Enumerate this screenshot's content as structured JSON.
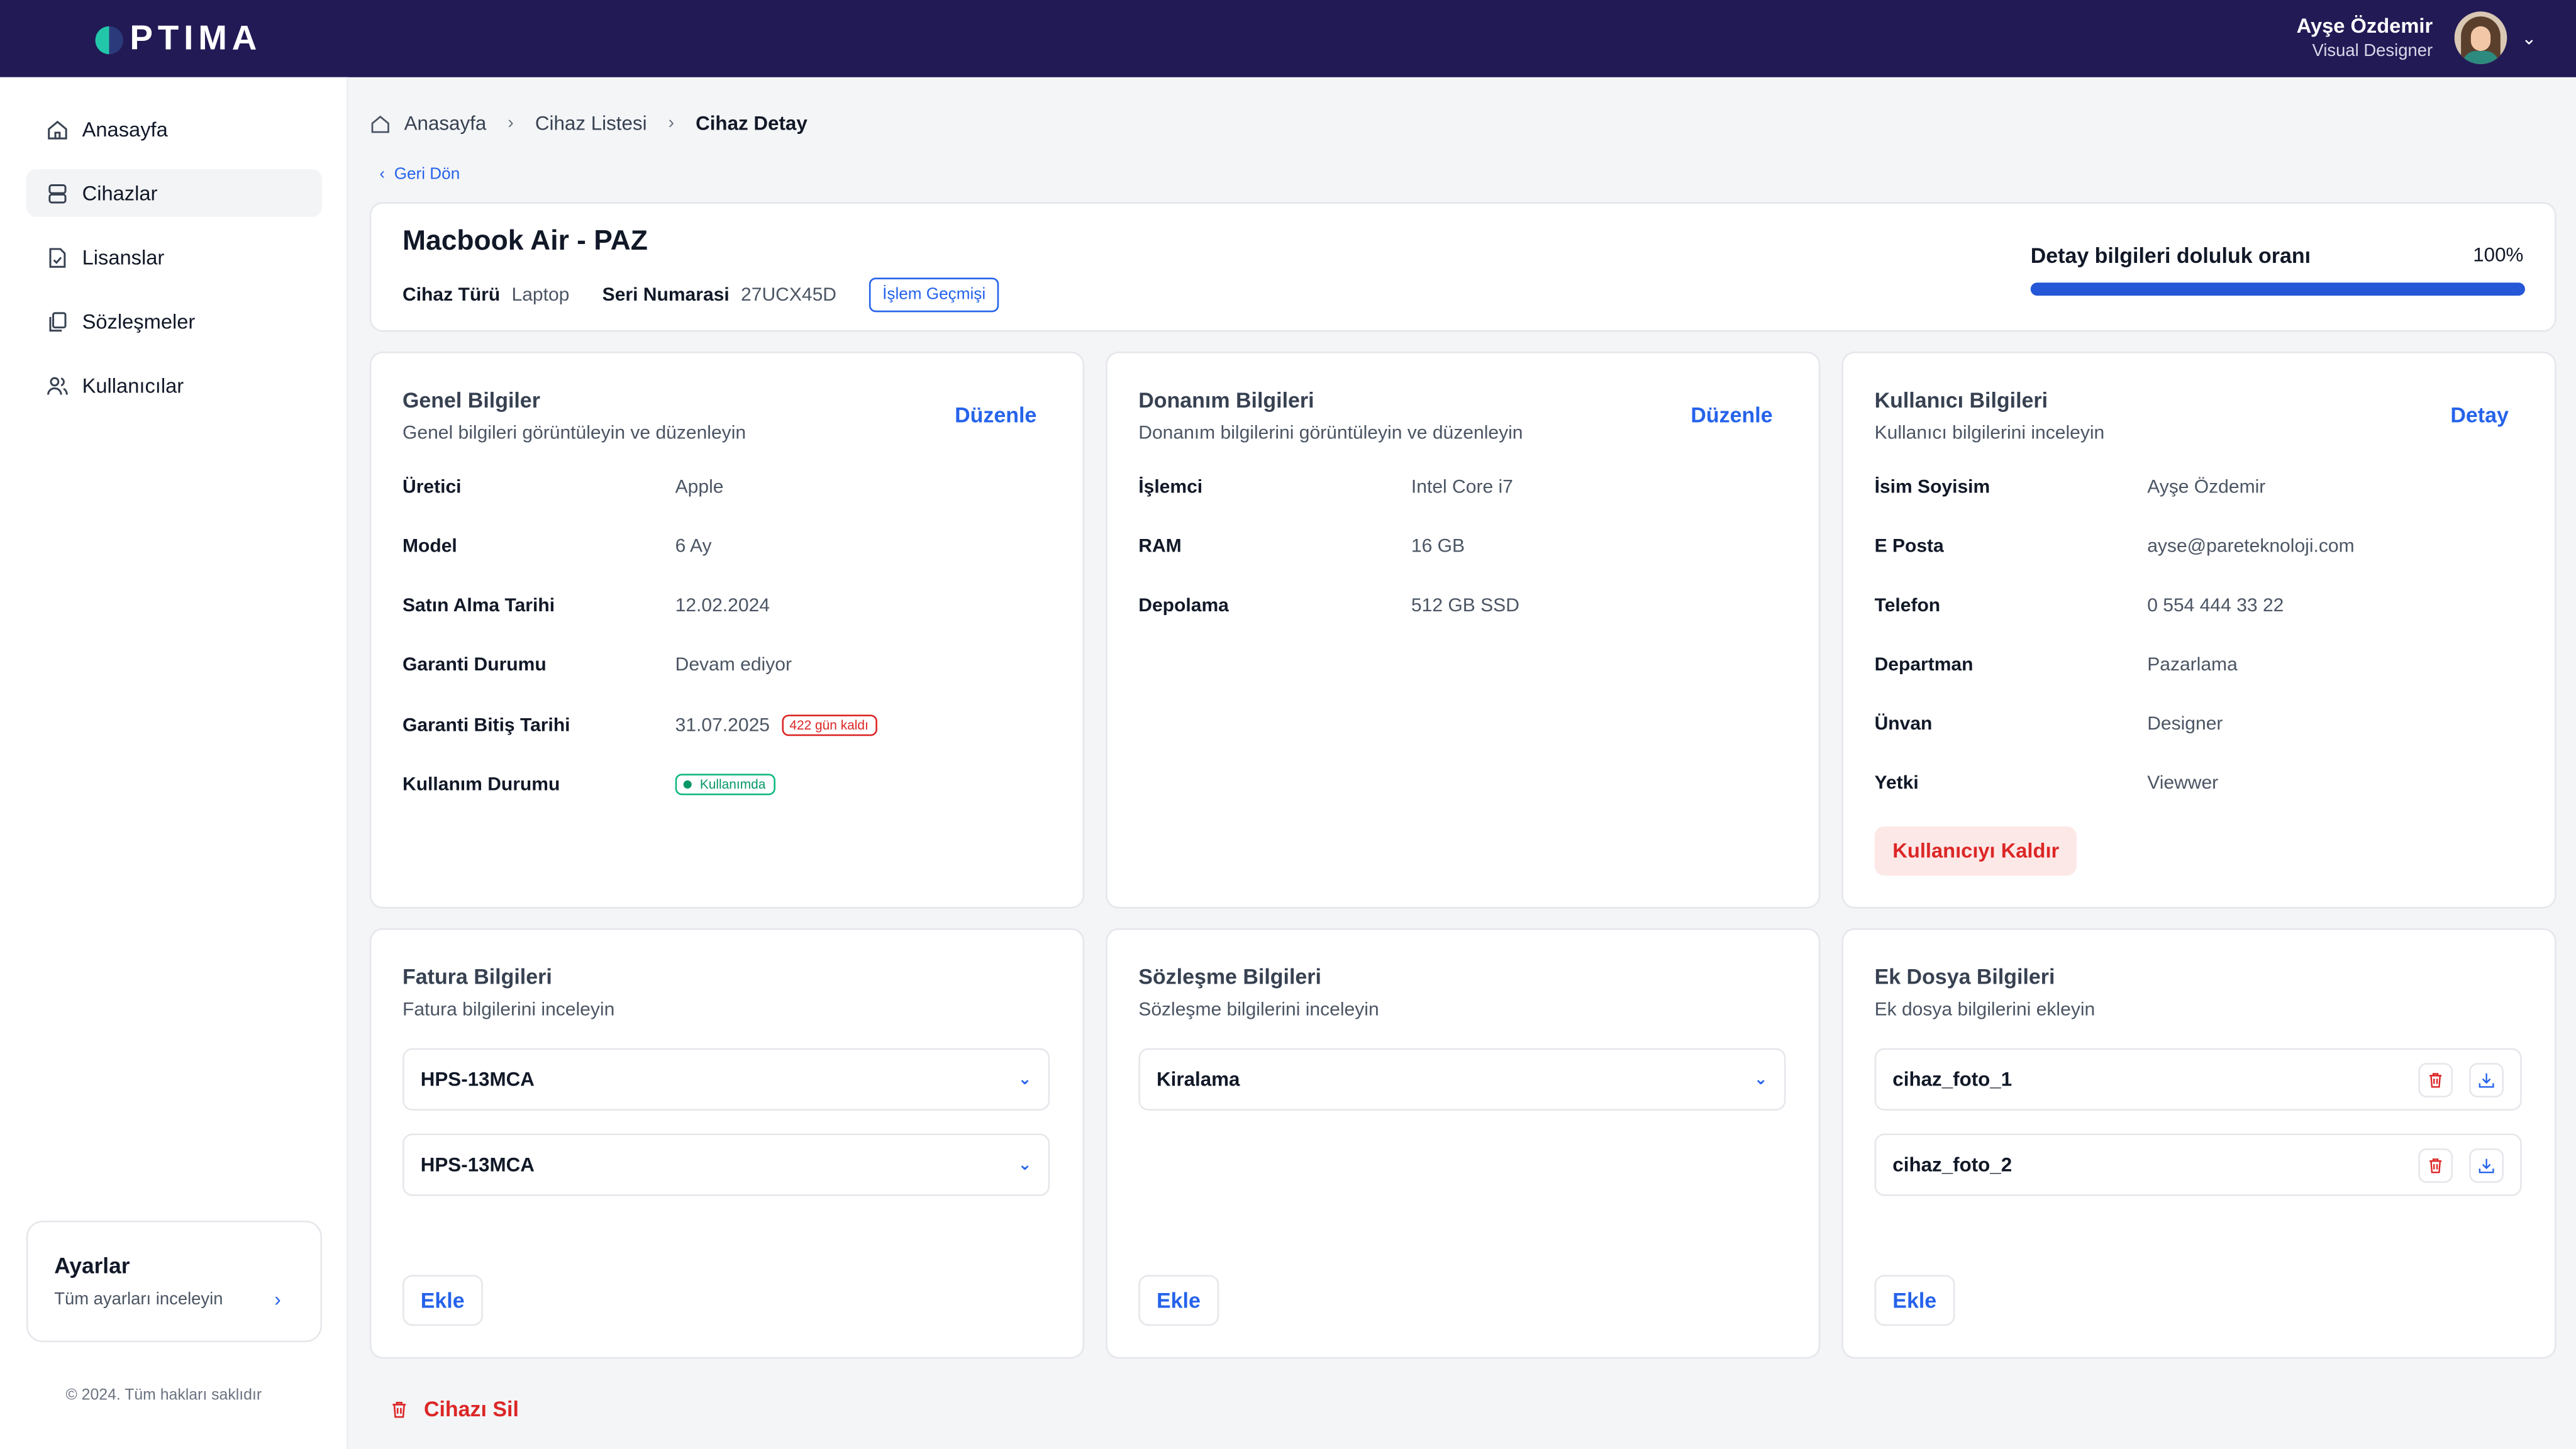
{
  "brand": {
    "logo_text": "PTIMA"
  },
  "user": {
    "name": "Ayşe Özdemir",
    "role": "Visual Designer"
  },
  "sidebar": {
    "items": [
      {
        "label": "Anasayfa",
        "icon": "home-icon"
      },
      {
        "label": "Cihazlar",
        "icon": "device-icon",
        "active": true
      },
      {
        "label": "Lisanslar",
        "icon": "license-icon"
      },
      {
        "label": "Sözleşmeler",
        "icon": "contracts-icon"
      },
      {
        "label": "Kullanıcılar",
        "icon": "users-icon"
      }
    ],
    "settings": {
      "title": "Ayarlar",
      "subtitle": "Tüm ayarları inceleyin"
    },
    "copyright": "© 2024. Tüm hakları saklıdır"
  },
  "breadcrumb": {
    "home": "Anasayfa",
    "list": "Cihaz Listesi",
    "current": "Cihaz Detay"
  },
  "back_label": "Geri Dön",
  "device": {
    "title": "Macbook Air - PAZ",
    "type_label": "Cihaz Türü",
    "type_value": "Laptop",
    "serial_label": "Seri Numarasi",
    "serial_value": "27UCX45D",
    "history_button": "İşlem Geçmişi",
    "completion_label": "Detay bilgileri doluluk oranı",
    "completion_text": "100%",
    "completion_value": 1.0
  },
  "general": {
    "title": "Genel Bilgiler",
    "subtitle": "Genel bilgileri görüntüleyin ve düzenleyin",
    "action": "Düzenle",
    "rows": [
      {
        "k": "Üretici",
        "v": "Apple"
      },
      {
        "k": "Model",
        "v": "6 Ay"
      },
      {
        "k": "Satın Alma Tarihi",
        "v": "12.02.2024"
      },
      {
        "k": "Garanti Durumu",
        "v": "Devam ediyor"
      },
      {
        "k": "Garanti Bitiş Tarihi",
        "v": "31.07.2025",
        "badge": "422 gün kaldı"
      },
      {
        "k": "Kullanım Durumu",
        "badge": "Kullanımda"
      }
    ]
  },
  "hardware": {
    "title": "Donanım Bilgileri",
    "subtitle": "Donanım bilgilerini görüntüleyin ve düzenleyin",
    "action": "Düzenle",
    "rows": [
      {
        "k": "İşlemci",
        "v": "Intel Core i7"
      },
      {
        "k": "RAM",
        "v": "16 GB"
      },
      {
        "k": "Depolama",
        "v": "512 GB SSD"
      }
    ]
  },
  "userinfo": {
    "title": "Kullanıcı Bilgileri",
    "subtitle": "Kullanıcı bilgilerini inceleyin",
    "action": "Detay",
    "rows": [
      {
        "k": "İsim Soyisim",
        "v": "Ayşe Özdemir"
      },
      {
        "k": "E Posta",
        "v": "ayse@pareteknoloji.com"
      },
      {
        "k": "Telefon",
        "v": "0 554 444 33 22"
      },
      {
        "k": "Departman",
        "v": "Pazarlama"
      },
      {
        "k": "Ünvan",
        "v": "Designer"
      },
      {
        "k": "Yetki",
        "v": "Viewwer"
      }
    ],
    "remove_button": "Kullanıcıyı Kaldır"
  },
  "invoice": {
    "title": "Fatura Bilgileri",
    "subtitle": "Fatura bilgilerini inceleyin",
    "items": [
      "HPS-13MCA",
      "HPS-13MCA"
    ],
    "add": "Ekle"
  },
  "contract": {
    "title": "Sözleşme Bilgileri",
    "subtitle": "Sözleşme bilgilerini inceleyin",
    "items": [
      "Kiralama"
    ],
    "add": "Ekle"
  },
  "attachments": {
    "title": "Ek Dosya Bilgileri",
    "subtitle": "Ek dosya bilgilerini ekleyin",
    "files": [
      "cihaz_foto_1",
      "cihaz_foto_2"
    ],
    "add": "Ekle"
  },
  "delete_device": "Cihazı Sil",
  "colors": {
    "topbar": "#221a55",
    "accent": "#2563eb",
    "danger": "#dc2626",
    "success": "#059669"
  }
}
